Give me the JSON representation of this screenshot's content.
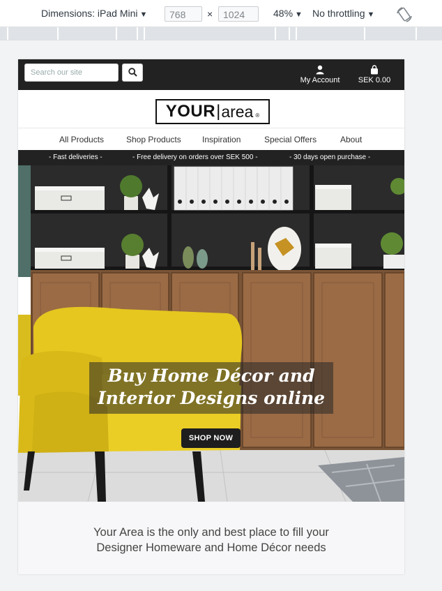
{
  "devtools": {
    "device_label": "Dimensions: iPad Mini",
    "width_value": "768",
    "times": "×",
    "height_value": "1024",
    "zoom": "48%",
    "throttling": "No throttling",
    "caret": "▼",
    "rotate_icon": "rotate-icon"
  },
  "site": {
    "search": {
      "placeholder": "Search our site",
      "icon": "search-icon"
    },
    "account": {
      "label": "My Account",
      "icon": "user-icon"
    },
    "cart": {
      "label": "SEK 0.00",
      "icon": "shopping-bag-icon"
    },
    "logo": {
      "bold": "YOUR",
      "sep": "|",
      "light": "area",
      "mark": "®"
    },
    "nav": [
      "All Products",
      "Shop Products",
      "Inspiration",
      "Special Offers",
      "About"
    ],
    "announcements": [
      "-  Fast deliveries  -",
      "-  Free delivery on orders over SEK 500  -",
      "-  30 days open purchase  -"
    ],
    "hero": {
      "title_line1": "Buy Home Décor and",
      "title_line2": "Interior Designs online",
      "button": "SHOP NOW"
    },
    "tagline": "Your Area is the only and best place to fill your Designer Homeware and Home Décor needs"
  }
}
